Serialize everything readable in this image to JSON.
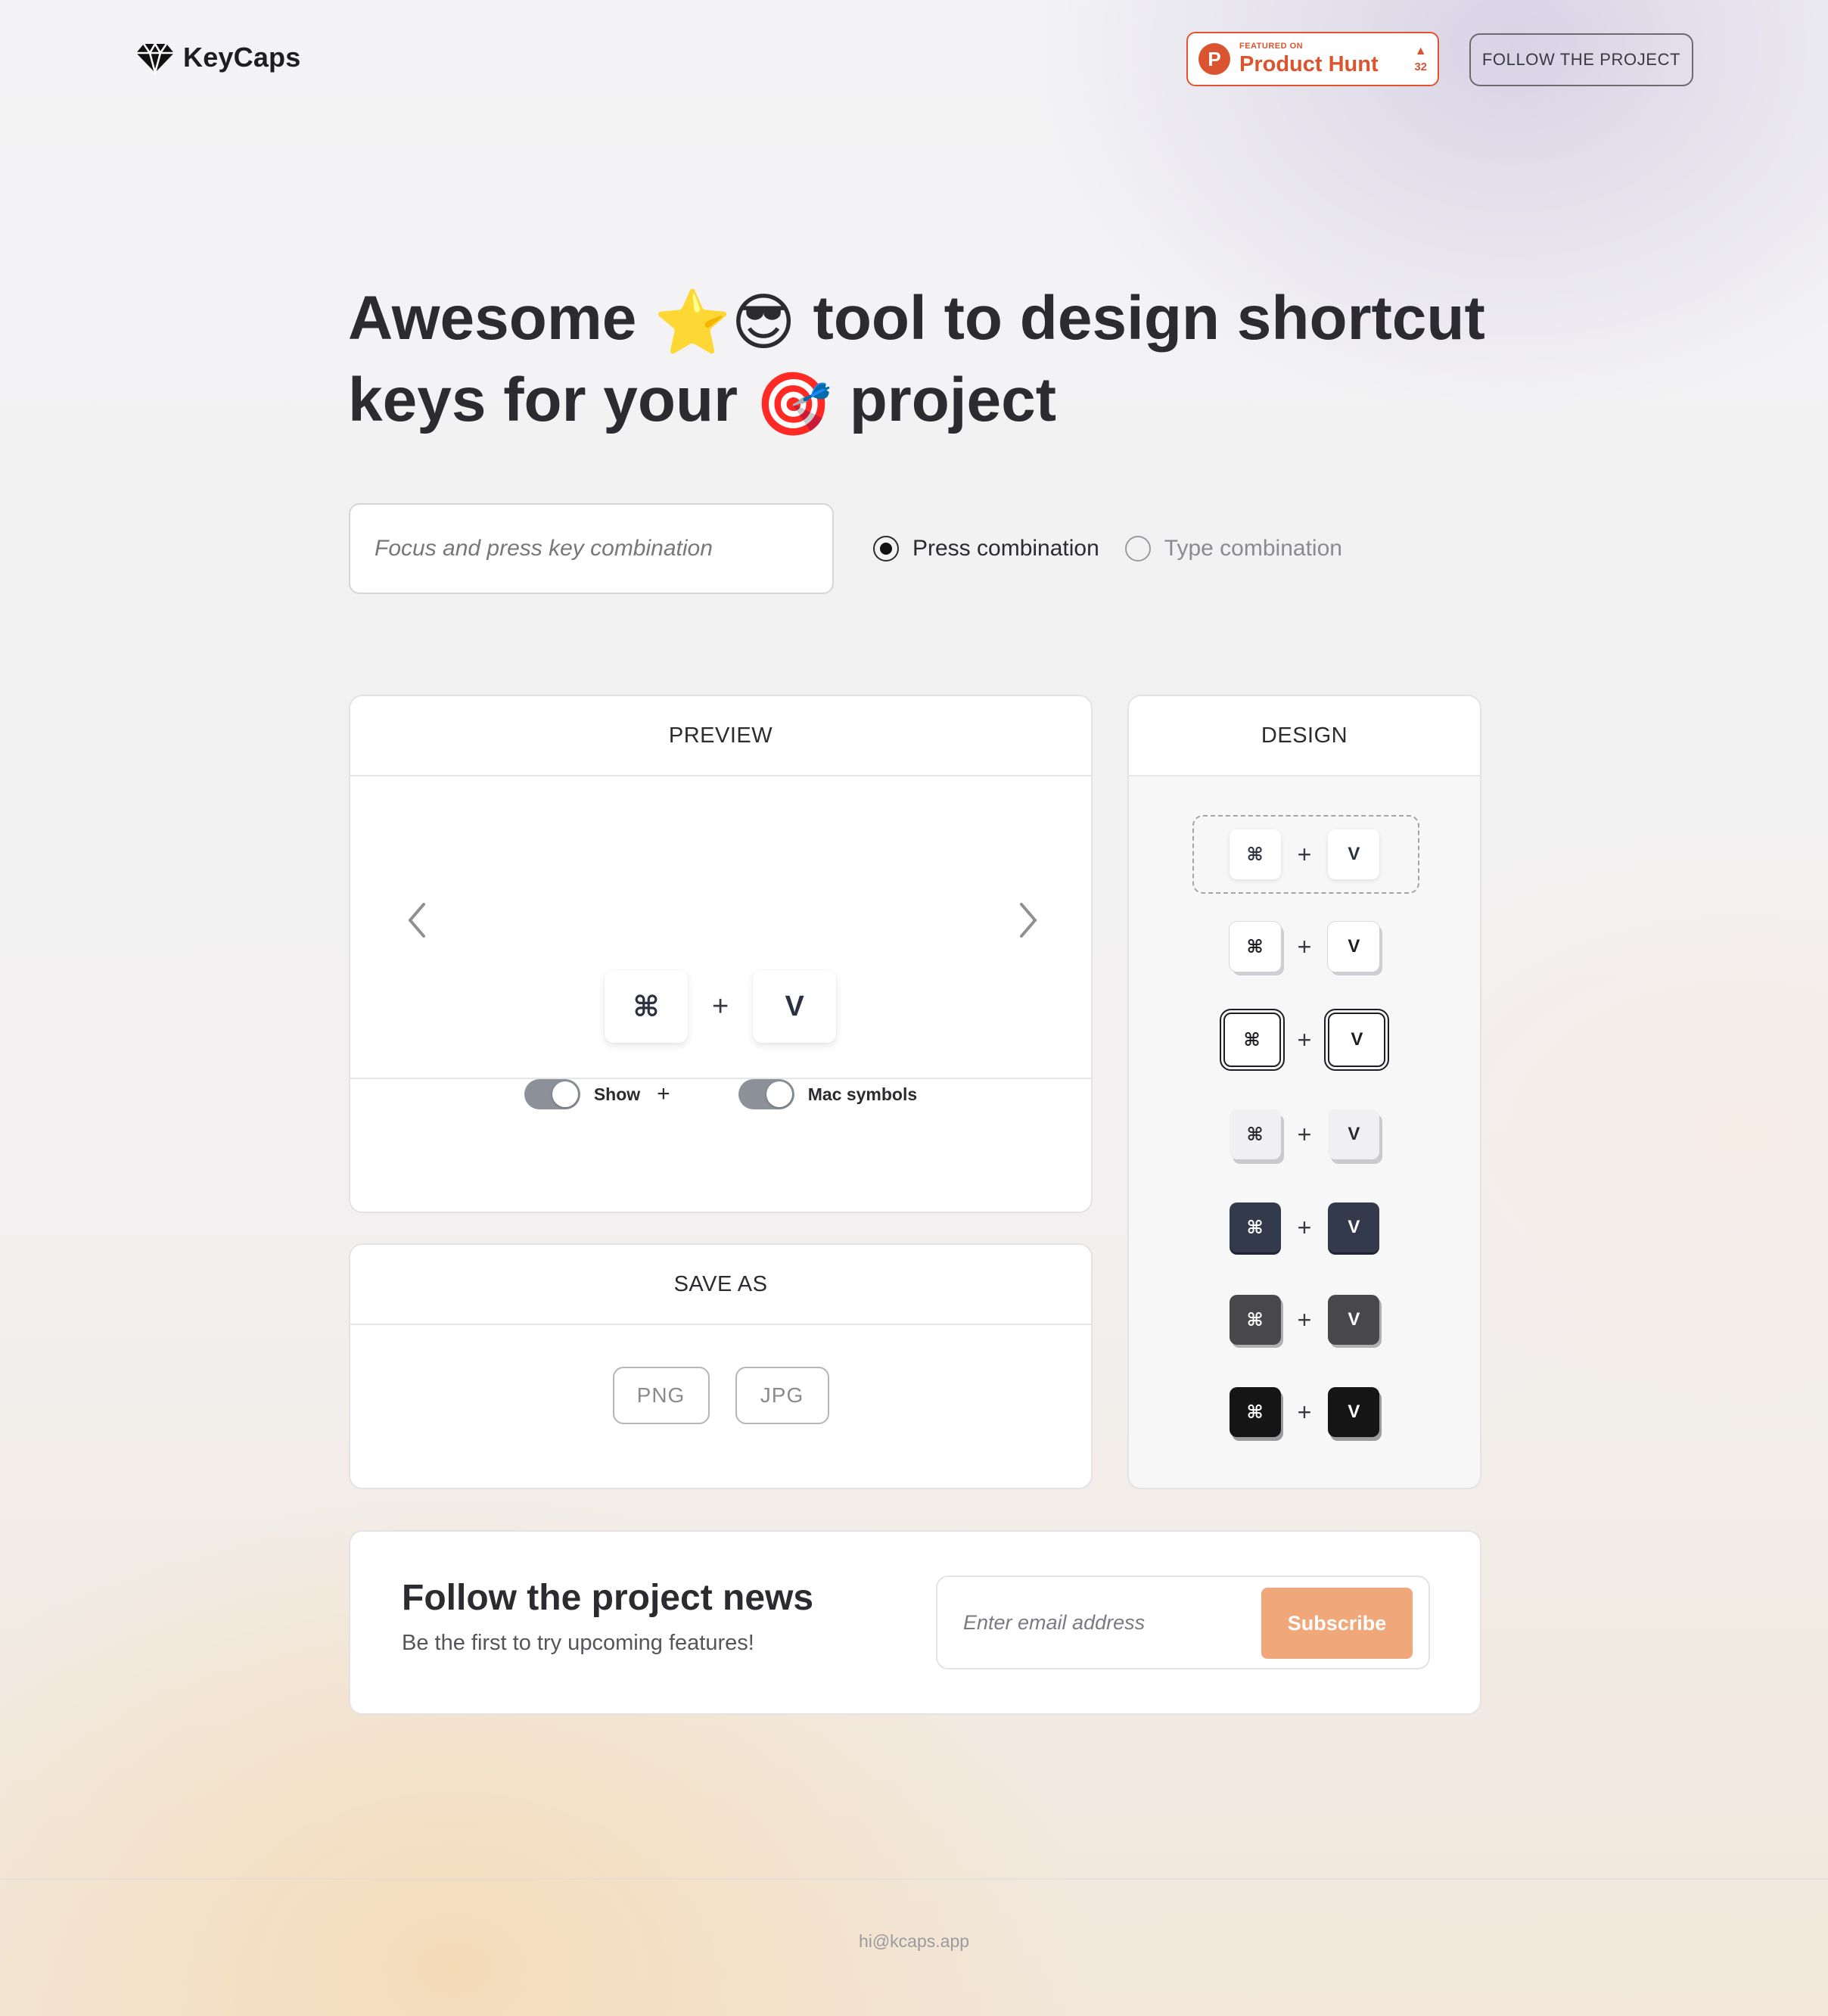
{
  "header": {
    "logo_text": "KeyCaps",
    "product_hunt": {
      "letter": "P",
      "featured_label": "FEATURED ON",
      "name": "Product Hunt",
      "upvote_arrow": "▲",
      "votes": "32"
    },
    "follow_button": "FOLLOW THE PROJECT"
  },
  "hero": {
    "part1": "Awesome",
    "emoji_star": "⭐",
    "emoji_sunglasses": "😎",
    "part2": "tool to design shortcut",
    "part3": "keys for your",
    "emoji_target": "🎯",
    "part4": "project"
  },
  "combo": {
    "input_placeholder": "Focus and press key combination",
    "input_value": "",
    "options": [
      {
        "label": "Press combination",
        "selected": true
      },
      {
        "label": "Type combination",
        "selected": false
      }
    ]
  },
  "preview": {
    "title": "PREVIEW",
    "keys": [
      "⌘",
      "V"
    ],
    "plus": "+",
    "toggles": [
      {
        "label": "Show",
        "suffix": "+",
        "on": true
      },
      {
        "label": "Mac symbols",
        "suffix": "",
        "on": true
      }
    ]
  },
  "save_as": {
    "title": "SAVE AS",
    "formats": [
      "PNG",
      "JPG"
    ]
  },
  "design": {
    "title": "DESIGN",
    "selected_style": 1,
    "styles": [
      {
        "key1": "⌘",
        "plus": "+",
        "key2": "V",
        "theme": "soft-white"
      },
      {
        "key1": "⌘",
        "plus": "+",
        "key2": "V",
        "theme": "white-offset-shadow"
      },
      {
        "key1": "⌘",
        "plus": "+",
        "key2": "V",
        "theme": "outlined"
      },
      {
        "key1": "⌘",
        "plus": "+",
        "key2": "V",
        "theme": "light-gray-3d"
      },
      {
        "key1": "⌘",
        "plus": "+",
        "key2": "V",
        "theme": "navy"
      },
      {
        "key1": "⌘",
        "plus": "+",
        "key2": "V",
        "theme": "dark-gray"
      },
      {
        "key1": "⌘",
        "plus": "+",
        "key2": "V",
        "theme": "black"
      }
    ]
  },
  "news": {
    "title": "Follow the project news",
    "subtitle": "Be the first to try upcoming features!",
    "email_placeholder": "Enter email address",
    "subscribe_label": "Subscribe",
    "accent": "#f0a77a"
  },
  "footer": {
    "email": "hi@kcaps.app"
  },
  "colors": {
    "product_hunt": "#da552f",
    "text": "#2b2b30",
    "navy_key": "#323a4c"
  }
}
